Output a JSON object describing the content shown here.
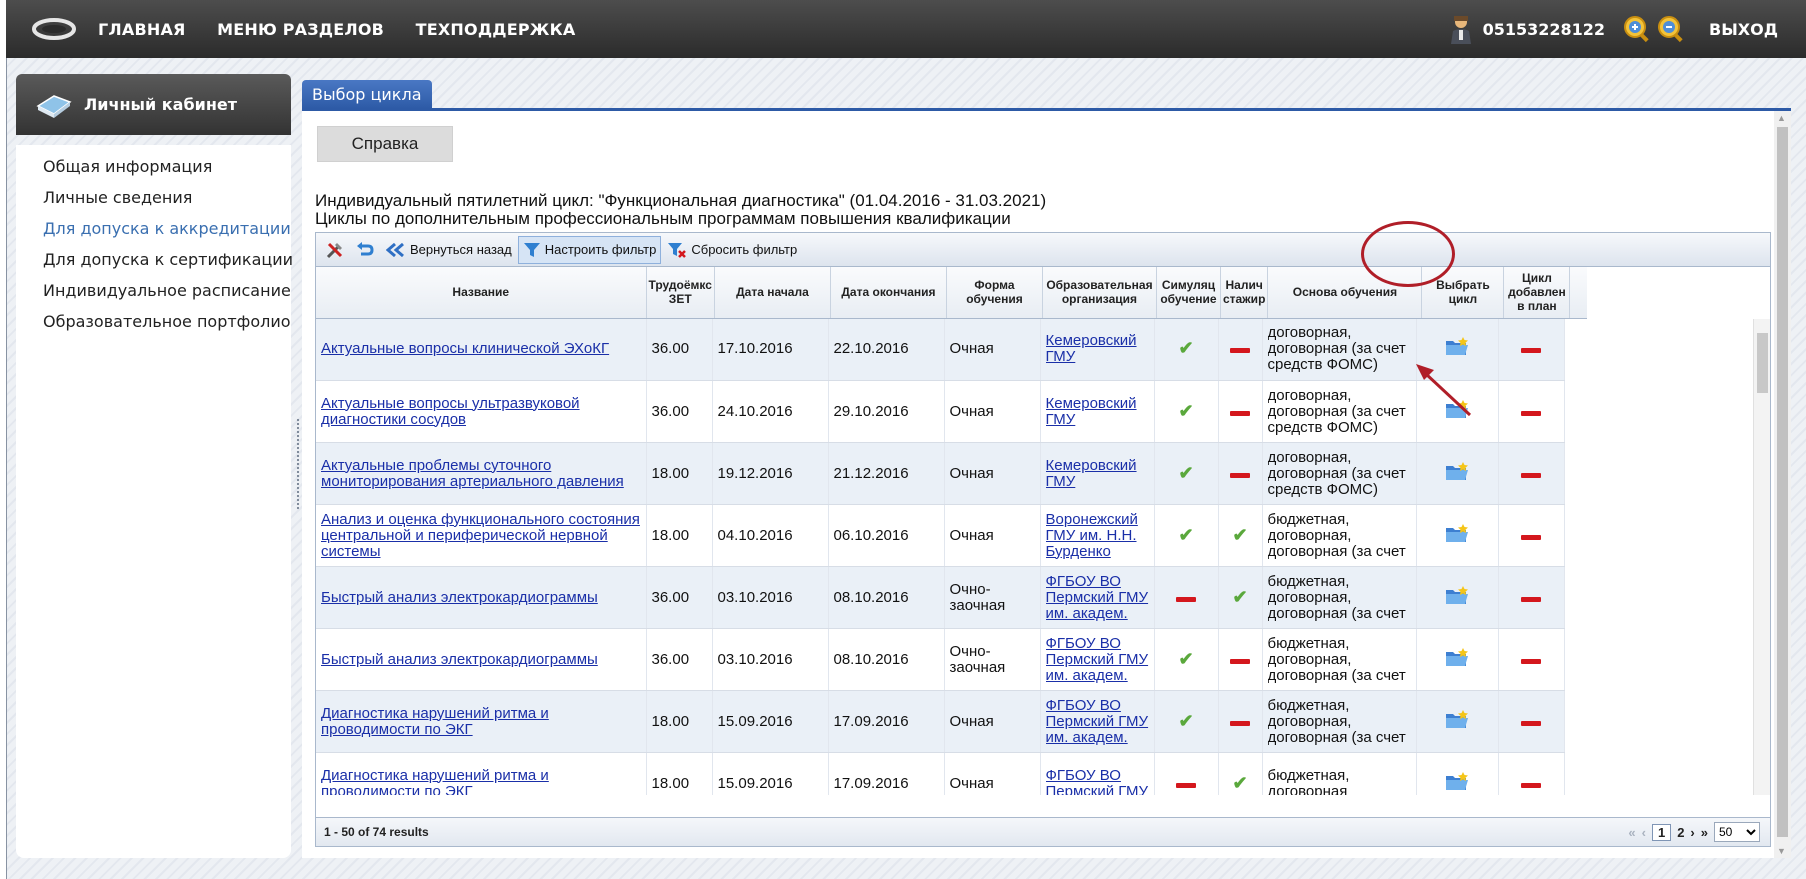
{
  "topbar": {
    "nav": [
      "ГЛАВНАЯ",
      "МЕНЮ РАЗДЕЛОВ",
      "ТЕХПОДДЕРЖКА"
    ],
    "user_id": "05153228122",
    "logout": "ВЫХОД"
  },
  "sidebar": {
    "header": "Личный кабинет",
    "items": [
      {
        "label": "Общая информация",
        "active": false
      },
      {
        "label": "Личные сведения",
        "active": false
      },
      {
        "label": "Для допуска к аккредитации",
        "active": true
      },
      {
        "label": "Для допуска к сертификации",
        "active": false
      },
      {
        "label": "Индивидуальное расписание",
        "active": false
      },
      {
        "label": "Образовательное портфолио",
        "active": false
      }
    ]
  },
  "main": {
    "tab": "Выбор цикла",
    "help_button": "Справка",
    "description_line1": "Индивидуальный пятилетний цикл: \"Функциональная диагностика\" (01.04.2016 - 31.03.2021)",
    "description_line2": "Циклы по дополнительным профессиональным программам повышения квалификации"
  },
  "toolbar": {
    "back": "Вернуться назад",
    "set_filter": "Настроить фильтр",
    "reset_filter": "Сбросить фильтр"
  },
  "table": {
    "columns": [
      "Название",
      "Трудоёмкс ЗЕТ",
      "Дата начала",
      "Дата окончания",
      "Форма обучения",
      "Образовательная организация",
      "Симуляц обучение",
      "Налич стажир",
      "Основа обучения",
      "Выбрать цикл",
      "Цикл добавлен в план"
    ],
    "rows": [
      {
        "name": "Актуальные вопросы клинической ЭХоКГ",
        "zet": "36.00",
        "start": "17.10.2016",
        "end": "22.10.2016",
        "form": "Очная",
        "org": "Кемеровский ГМУ",
        "sim": "yes",
        "intern": "no",
        "basis": "договорная, договорная (за счет средств ФОМС)",
        "added": "no"
      },
      {
        "name": "Актуальные вопросы ультразвуковой диагностики сосудов",
        "zet": "36.00",
        "start": "24.10.2016",
        "end": "29.10.2016",
        "form": "Очная",
        "org": "Кемеровский ГМУ",
        "sim": "yes",
        "intern": "no",
        "basis": "договорная, договорная (за счет средств ФОМС)",
        "added": "no"
      },
      {
        "name": "Актуальные проблемы суточного мониторирования артериального давления",
        "zet": "18.00",
        "start": "19.12.2016",
        "end": "21.12.2016",
        "form": "Очная",
        "org": "Кемеровский ГМУ",
        "sim": "yes",
        "intern": "no",
        "basis": "договорная, договорная (за счет средств ФОМС)",
        "added": "no"
      },
      {
        "name": "Анализ и оценка функционального состояния центральной и периферической нервной системы",
        "zet": "18.00",
        "start": "04.10.2016",
        "end": "06.10.2016",
        "form": "Очная",
        "org": "Воронежский ГМУ им. Н.Н. Бурденко",
        "sim": "yes",
        "intern": "yes",
        "basis": "бюджетная, договорная, договорная (за счет",
        "added": "no"
      },
      {
        "name": "Быстрый анализ электрокардиограммы",
        "zet": "36.00",
        "start": "03.10.2016",
        "end": "08.10.2016",
        "form": "Очно-заочная",
        "org": "ФГБОУ ВО Пермский ГМУ им. академ.",
        "sim": "no",
        "intern": "yes",
        "basis": "бюджетная, договорная, договорная (за счет",
        "added": "no"
      },
      {
        "name": "Быстрый анализ электрокардиограммы",
        "zet": "36.00",
        "start": "03.10.2016",
        "end": "08.10.2016",
        "form": "Очно-заочная",
        "org": "ФГБОУ ВО Пермский ГМУ им. академ.",
        "sim": "yes",
        "intern": "no",
        "basis": "бюджетная, договорная, договорная (за счет",
        "added": "no"
      },
      {
        "name": "Диагностика нарушений ритма и проводимости по ЭКГ",
        "zet": "18.00",
        "start": "15.09.2016",
        "end": "17.09.2016",
        "form": "Очная",
        "org": "ФГБОУ ВО Пермский ГМУ им. академ.",
        "sim": "yes",
        "intern": "no",
        "basis": "бюджетная, договорная, договорная (за счет",
        "added": "no"
      },
      {
        "name": "Диагностика нарушений ритма и проводимости по ЭКГ",
        "zet": "18.00",
        "start": "15.09.2016",
        "end": "17.09.2016",
        "form": "Очная",
        "org": "ФГБОУ ВО Пермский ГМУ",
        "sim": "no",
        "intern": "yes",
        "basis": "бюджетная, договорная",
        "added": "no"
      }
    ]
  },
  "pager": {
    "summary": "1 - 50 of 74 results",
    "first": "«",
    "prev": "‹",
    "current": "1",
    "next_page": "2",
    "next": "›",
    "last": "»",
    "page_size": "50"
  },
  "colors": {
    "accent": "#2d5aa6",
    "link": "#1a2fa8",
    "check": "#5aa83c",
    "minus": "#d4171d",
    "annotation": "#b01e28"
  }
}
